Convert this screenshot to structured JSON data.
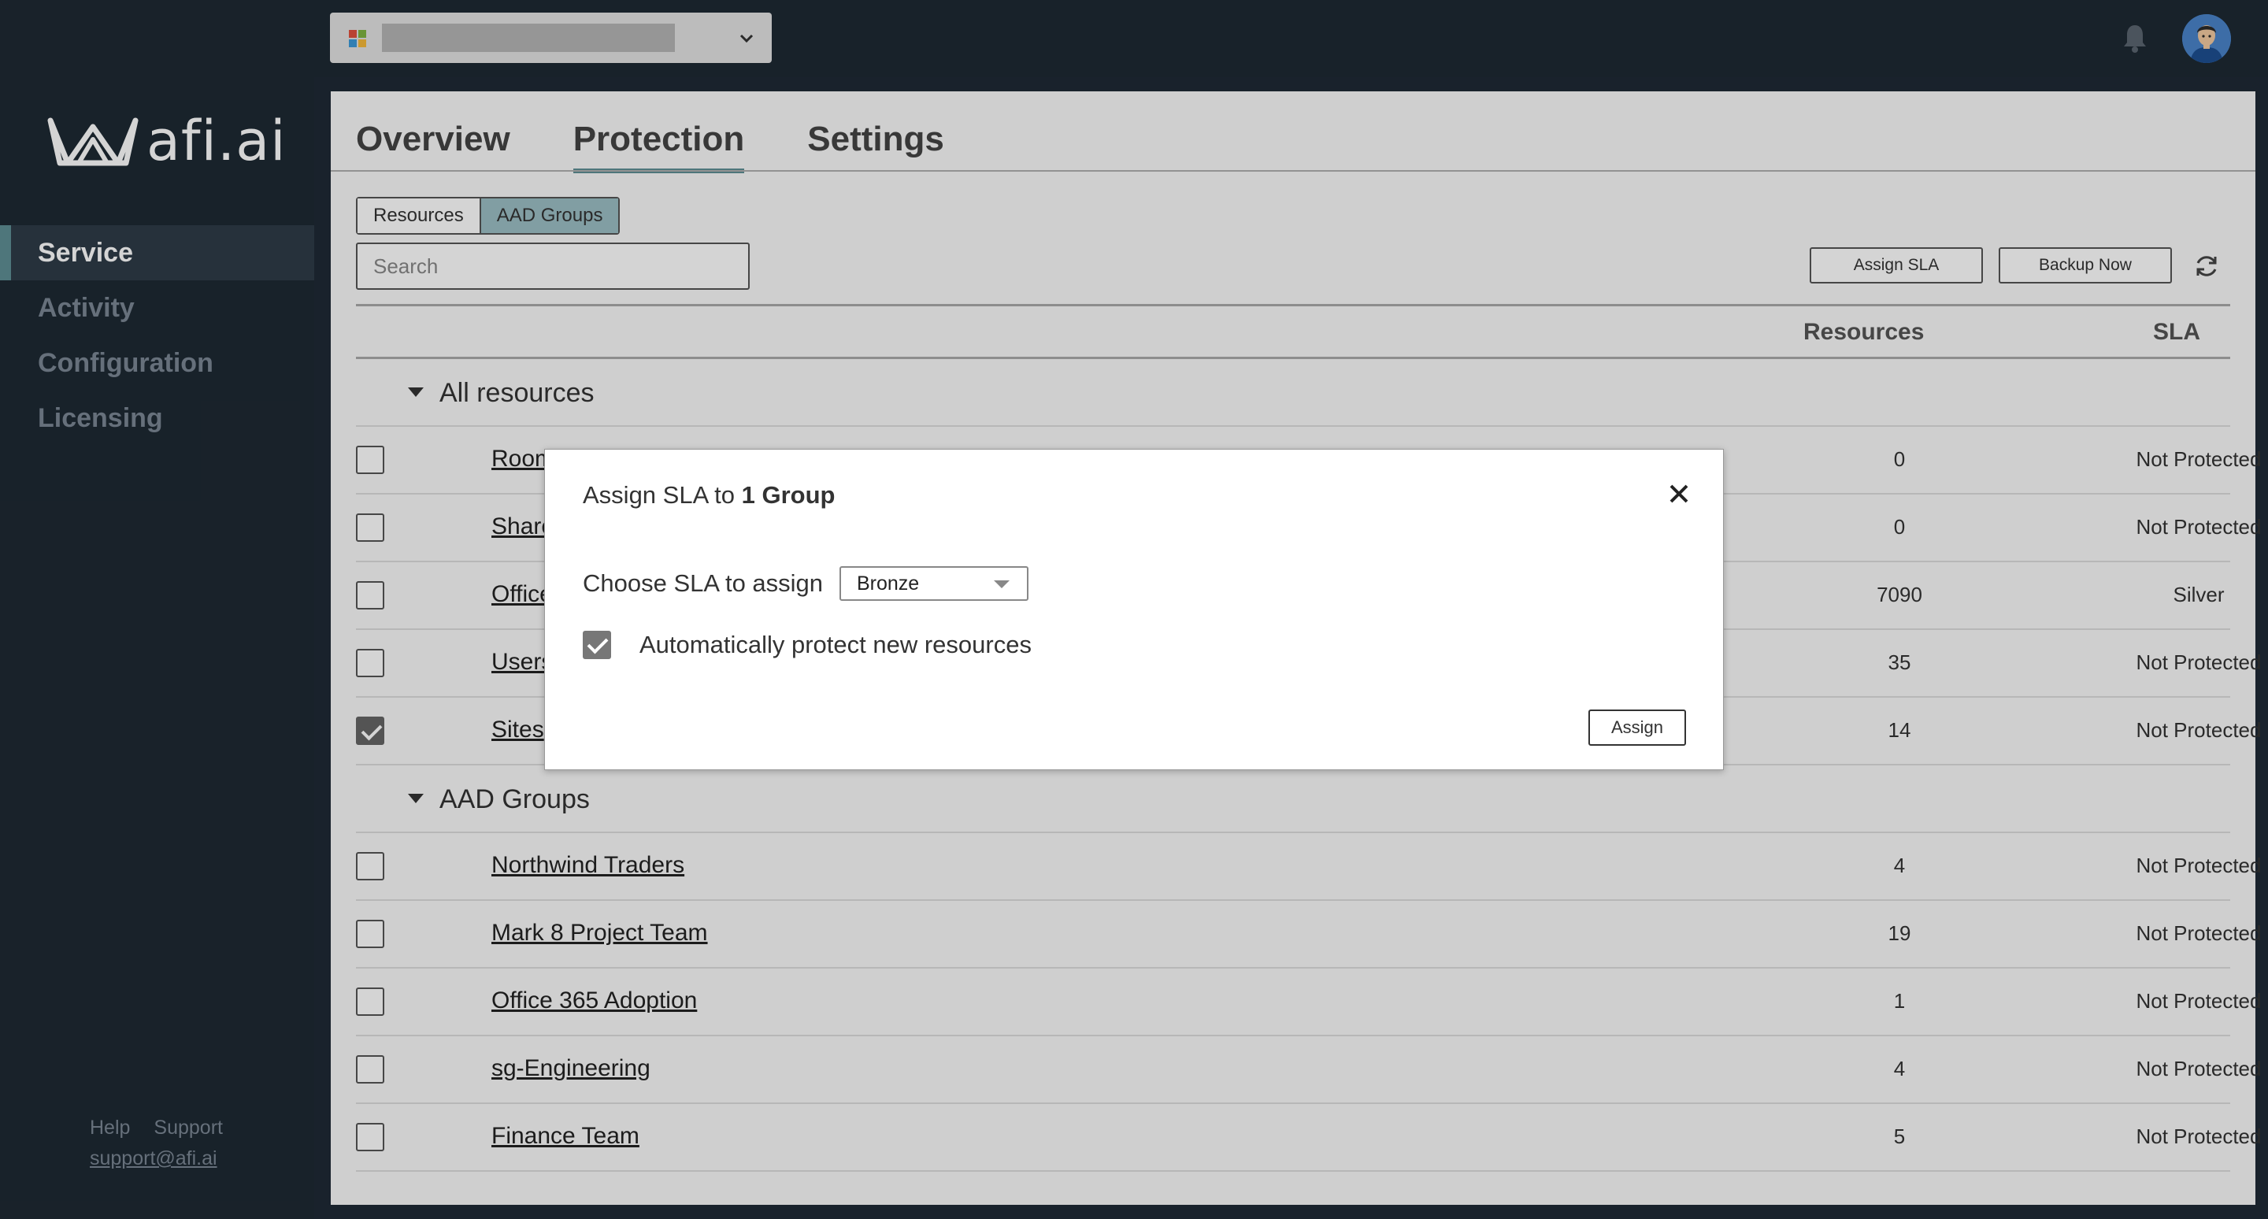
{
  "brand": {
    "name": "afi.ai"
  },
  "sidebar": {
    "items": [
      {
        "label": "Service",
        "active": true
      },
      {
        "label": "Activity",
        "active": false
      },
      {
        "label": "Configuration",
        "active": false
      },
      {
        "label": "Licensing",
        "active": false
      }
    ],
    "footer": {
      "help": "Help",
      "support": "Support",
      "email": "support@afi.ai"
    }
  },
  "topbar": {
    "tenant_icon": "microsoft-logo-icon",
    "dropdown_icon": "chevron-down-icon",
    "notification_icon": "bell-icon",
    "avatar_icon": "user-avatar-icon"
  },
  "tabs": [
    {
      "label": "Overview",
      "active": false
    },
    {
      "label": "Protection",
      "active": true
    },
    {
      "label": "Settings",
      "active": false
    }
  ],
  "view_toggle": {
    "resources": "Resources",
    "aad_groups": "AAD Groups",
    "selected": "AAD Groups"
  },
  "search": {
    "placeholder": "Search",
    "value": ""
  },
  "toolbar": {
    "assign_sla": "Assign SLA",
    "backup_now": "Backup Now",
    "refresh_icon": "refresh-icon"
  },
  "table": {
    "columns": {
      "resources": "Resources",
      "sla": "SLA"
    },
    "groups": [
      {
        "label": "All resources",
        "rows": [
          {
            "name": "Room",
            "resources": "0",
            "sla": "Not Protected",
            "checked": false
          },
          {
            "name": "Share",
            "resources": "0",
            "sla": "Not Protected",
            "checked": false
          },
          {
            "name": "Office",
            "resources": "7090",
            "sla": "Silver",
            "checked": false
          },
          {
            "name": "Users",
            "resources": "35",
            "sla": "Not Protected",
            "checked": false
          },
          {
            "name": "Sites",
            "resources": "14",
            "sla": "Not Protected",
            "checked": true
          }
        ]
      },
      {
        "label": "AAD Groups",
        "rows": [
          {
            "name": "Northwind Traders",
            "resources": "4",
            "sla": "Not Protected",
            "checked": false
          },
          {
            "name": "Mark 8 Project Team",
            "resources": "19",
            "sla": "Not Protected",
            "checked": false
          },
          {
            "name": "Office 365 Adoption",
            "resources": "1",
            "sla": "Not Protected",
            "checked": false
          },
          {
            "name": "sg-Engineering",
            "resources": "4",
            "sla": "Not Protected",
            "checked": false
          },
          {
            "name": "Finance Team",
            "resources": "5",
            "sla": "Not Protected",
            "checked": false
          }
        ]
      }
    ]
  },
  "modal": {
    "title_prefix": "Assign SLA to ",
    "title_bold": "1 Group",
    "choose_label": "Choose SLA to assign",
    "sla_value": "Bronze",
    "auto_protect_label": "Automatically protect new resources",
    "auto_protect_checked": true,
    "assign_button": "Assign",
    "close_icon": "close-icon"
  },
  "colors": {
    "accent": "#5e8e95",
    "sidebar_bg": "#1e2933",
    "toggle_active": "#9cbfc5"
  }
}
